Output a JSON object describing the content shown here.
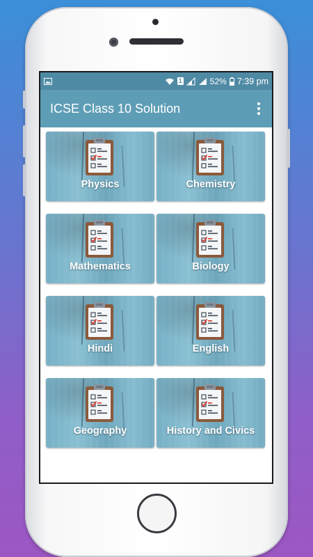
{
  "status_bar": {
    "battery_percent": "52%",
    "time": "7:39 pm",
    "sim_number": "1"
  },
  "app_bar": {
    "title": "ICSE Class 10 Solution",
    "menu_icon": "overflow-menu-icon"
  },
  "subjects": [
    {
      "label": "Physics",
      "icon": "clipboard-checklist-icon"
    },
    {
      "label": "Chemistry",
      "icon": "clipboard-checklist-icon"
    },
    {
      "label": "Mathematics",
      "icon": "clipboard-checklist-icon"
    },
    {
      "label": "Biology",
      "icon": "clipboard-checklist-icon"
    },
    {
      "label": "Hindi",
      "icon": "clipboard-checklist-icon"
    },
    {
      "label": "English",
      "icon": "clipboard-checklist-icon"
    },
    {
      "label": "Geography",
      "icon": "clipboard-checklist-icon"
    },
    {
      "label": "History and Civics",
      "icon": "clipboard-checklist-icon"
    }
  ],
  "colors": {
    "app_bar": "#5e9db6",
    "status_bar": "#4f8aa4",
    "card_base": "#7fb6cb",
    "check_red": "#d9392c",
    "clipboard_brown": "#8b5a3c"
  }
}
